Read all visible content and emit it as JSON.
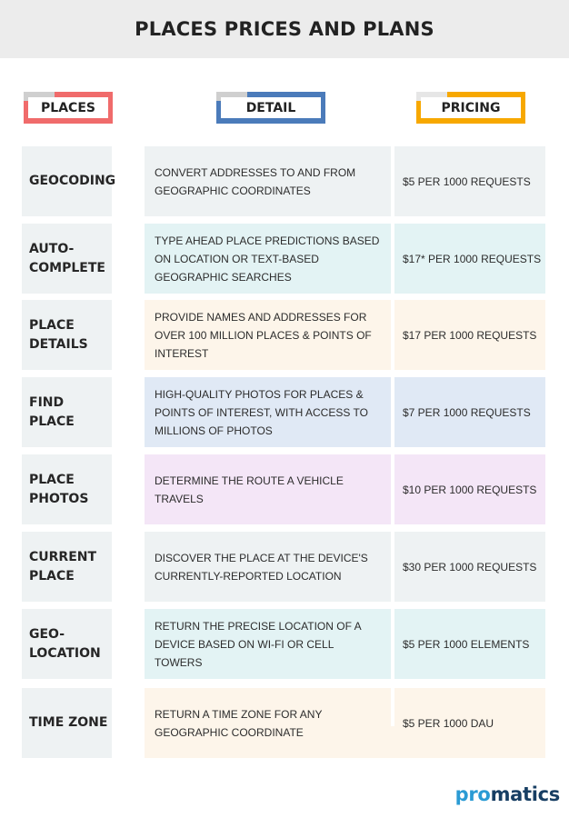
{
  "title": "PLACES PRICES AND PLANS",
  "headers": {
    "places": "PLACES",
    "detail": "DETAIL",
    "pricing": "PRICING"
  },
  "colors": {
    "places_accent": "#f06b6b",
    "detail_accent": "#4b7bba",
    "pricing_accent": "#f7a800",
    "logo_primary": "#2b9bd4",
    "logo_secondary": "#173e63"
  },
  "rows": [
    {
      "name": "GEOCODING",
      "detail": "CONVERT ADDRESSES TO AND FROM GEOGRAPHIC COORDINATES",
      "price": "$5 PER 1000 REQUESTS",
      "bg": "#eef2f3"
    },
    {
      "name": "AUTO-\nCOMPLETE",
      "detail": "TYPE AHEAD PLACE PREDICTIONS BASED ON LOCATION OR TEXT-BASED GEOGRAPHIC SEARCHES",
      "price": "$17* PER 1000 REQUESTS",
      "bg": "#e3f3f4"
    },
    {
      "name": "PLACE\nDETAILS",
      "detail": "PROVIDE NAMES AND ADDRESSES FOR OVER 100 MILLION PLACES & POINTS OF INTEREST",
      "price": "$17 PER 1000 REQUESTS",
      "bg": "#fdf5ea"
    },
    {
      "name": "FIND PLACE",
      "detail": "HIGH-QUALITY PHOTOS FOR PLACES & POINTS OF INTEREST, WITH ACCESS TO MILLIONS OF PHOTOS",
      "price": "$7 PER 1000 REQUESTS",
      "bg": "#e0e9f5"
    },
    {
      "name": "PLACE\nPHOTOS",
      "detail": "DETERMINE THE ROUTE A VEHICLE TRAVELS",
      "price": "$10 PER 1000 REQUESTS",
      "bg": "#f4e6f7"
    },
    {
      "name": "CURRENT\nPLACE",
      "detail": "DISCOVER THE PLACE AT THE DEVICE'S CURRENTLY-REPORTED LOCATION",
      "price": "$30 PER 1000 REQUESTS",
      "bg": "#eef2f3"
    },
    {
      "name": "GEO-\nLOCATION",
      "detail": "RETURN THE PRECISE LOCATION OF A DEVICE BASED ON WI-FI OR CELL TOWERS",
      "price": "$5 PER 1000 ELEMENTS",
      "bg": "#e3f3f4"
    },
    {
      "name": "TIME ZONE",
      "detail": "RETURN A TIME ZONE FOR ANY GEOGRAPHIC COORDINATE",
      "price": "$5 PER 1000 DAU",
      "bg": "#fdf5ea"
    }
  ],
  "logo": {
    "part1": "pro",
    "part2": "matics"
  }
}
